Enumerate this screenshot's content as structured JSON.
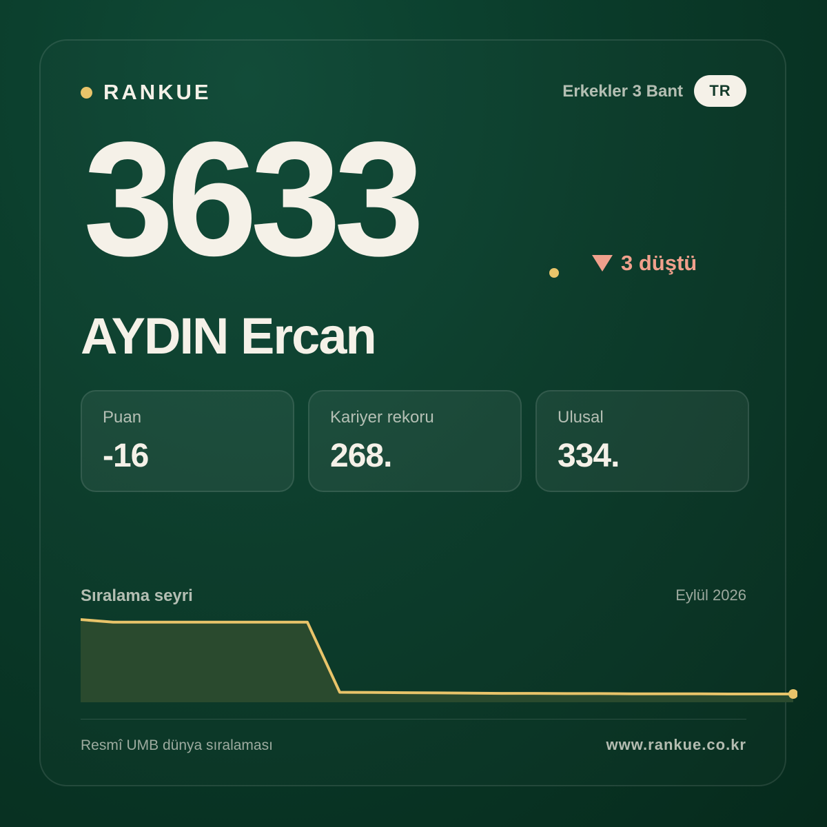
{
  "brand": {
    "name": "RANKUE",
    "accent": "#e9c46a"
  },
  "header": {
    "category": "Erkekler 3 Bant",
    "country": "TR"
  },
  "rank": {
    "value": "3633",
    "change_text": "3 düştü",
    "change_direction": "down",
    "change_color": "#f0a08c"
  },
  "player": {
    "name": "AYDIN Ercan"
  },
  "stats": [
    {
      "label": "Puan",
      "value": "-16"
    },
    {
      "label": "Kariyer rekoru",
      "value": "268."
    },
    {
      "label": "Ulusal",
      "value": "334."
    }
  ],
  "trend": {
    "title": "Sıralama seyri",
    "date": "Eylül 2026",
    "line_color": "#e9c46a",
    "fill_color": "#2a4a2e",
    "values": [
      3290,
      3302,
      3302,
      3302,
      3302,
      3302,
      3302,
      3302,
      3625,
      3626,
      3627,
      3628,
      3629,
      3630,
      3630,
      3631,
      3631,
      3632,
      3632,
      3632,
      3633,
      3633,
      3633
    ]
  },
  "footer": {
    "source": "Resmî UMB dünya sıralaması",
    "website": "www.rankue.co.kr"
  }
}
